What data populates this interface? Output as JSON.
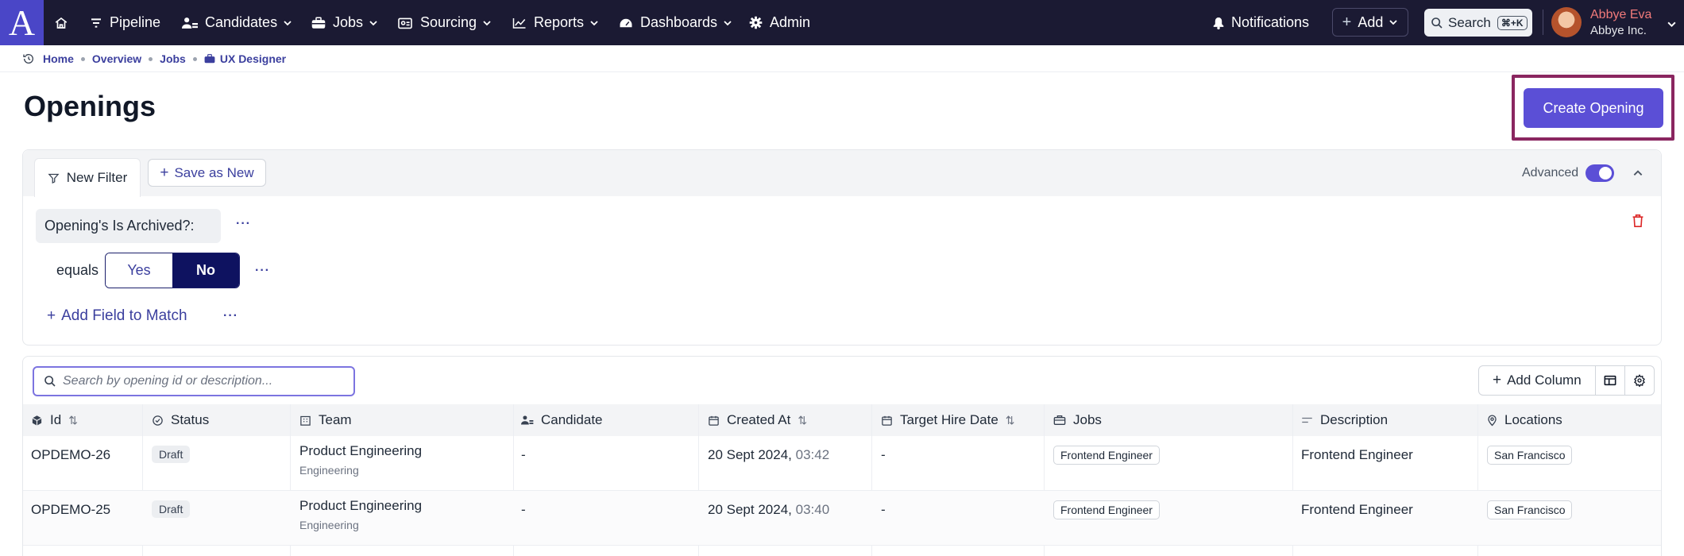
{
  "nav": {
    "logo": "A",
    "items": [
      {
        "label": "Pipeline",
        "icon": "filter-lines-icon"
      },
      {
        "label": "Candidates",
        "icon": "people-icon"
      },
      {
        "label": "Jobs",
        "icon": "briefcase-icon"
      },
      {
        "label": "Sourcing",
        "icon": "id-card-icon"
      },
      {
        "label": "Reports",
        "icon": "chart-line-icon"
      },
      {
        "label": "Dashboards",
        "icon": "gauge-icon"
      },
      {
        "label": "Admin",
        "icon": "gear-icon"
      }
    ],
    "notifications": "Notifications",
    "add": "Add",
    "search": "Search",
    "search_kbd": "⌘+K",
    "user_name": "Abbye Eva",
    "user_company": "Abbye Inc."
  },
  "breadcrumb": [
    "Home",
    "Overview",
    "Jobs",
    "UX Designer"
  ],
  "page": {
    "title": "Openings",
    "create_button": "Create Opening"
  },
  "filter": {
    "tab_label": "New Filter",
    "save_label": "Save as New",
    "advanced_label": "Advanced",
    "advanced_on": true,
    "field_label": "Opening's Is Archived?:",
    "operator": "equals",
    "options": [
      "Yes",
      "No"
    ],
    "selected": "No",
    "add_field_label": "Add Field to Match",
    "more": "···"
  },
  "table": {
    "search_placeholder": "Search by opening id or description...",
    "add_column_label": "Add Column",
    "columns": [
      "Id",
      "Status",
      "Team",
      "Candidate",
      "Created At",
      "Target Hire Date",
      "Jobs",
      "Description",
      "Locations"
    ],
    "rows": [
      {
        "id": "OPDEMO-26",
        "status": "Draft",
        "team": "Product Engineering",
        "team_sub": "Engineering",
        "candidate": "-",
        "created_date": "20 Sept 2024,",
        "created_time": "03:42",
        "target": "-",
        "job": "Frontend Engineer",
        "description": "Frontend Engineer",
        "location": "San Francisco"
      },
      {
        "id": "OPDEMO-25",
        "status": "Draft",
        "team": "Product Engineering",
        "team_sub": "Engineering",
        "candidate": "-",
        "created_date": "20 Sept 2024,",
        "created_time": "03:40",
        "target": "-",
        "job": "Frontend Engineer",
        "description": "Frontend Engineer",
        "location": "San Francisco"
      }
    ]
  },
  "colors": {
    "nav_bg": "#1b1a33",
    "accent": "#5b4fd6",
    "link": "#3b3f9e",
    "selected_seg": "#0e1260",
    "highlight_box": "#8a2660"
  }
}
